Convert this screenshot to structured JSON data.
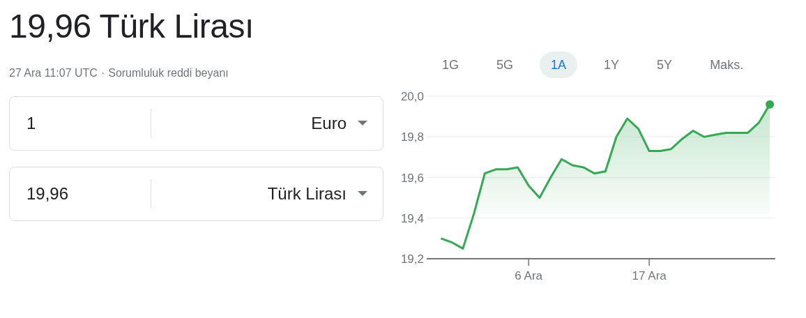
{
  "title": "19,96 Türk Lirası",
  "meta": {
    "timestamp": "27 Ara 11:07 UTC",
    "separator": "·",
    "disclaimer": "Sorumluluk reddi beyanı"
  },
  "converter": [
    {
      "amount": "1",
      "currency": "Euro"
    },
    {
      "amount": "19,96",
      "currency": "Türk Lirası"
    }
  ],
  "ranges": [
    {
      "label": "1G",
      "selected": false
    },
    {
      "label": "5G",
      "selected": false
    },
    {
      "label": "1A",
      "selected": true
    },
    {
      "label": "1Y",
      "selected": false
    },
    {
      "label": "5Y",
      "selected": false
    },
    {
      "label": "Maks.",
      "selected": false
    }
  ],
  "chart_data": {
    "type": "area",
    "categories": [
      null,
      null,
      null,
      null,
      null,
      null,
      null,
      null,
      "6 Ara",
      null,
      null,
      null,
      null,
      null,
      null,
      null,
      null,
      null,
      null,
      "17 Ara",
      null,
      null,
      null,
      null,
      null,
      null,
      null,
      null,
      null,
      null,
      null
    ],
    "series": [
      {
        "color": "#34a853",
        "values": [
          19.3,
          19.28,
          19.25,
          19.42,
          19.62,
          19.64,
          19.64,
          19.65,
          19.56,
          19.5,
          19.6,
          19.69,
          19.66,
          19.65,
          19.62,
          19.63,
          19.8,
          19.89,
          19.84,
          19.73,
          19.73,
          19.74,
          19.79,
          19.83,
          19.8,
          19.81,
          19.82,
          19.82,
          19.82,
          19.87,
          19.96
        ]
      }
    ],
    "ylim": [
      19.2,
      20.0
    ],
    "grid": true,
    "yticks": [
      {
        "value": 20.0,
        "label": "20,0"
      },
      {
        "value": 19.8,
        "label": "19,8"
      },
      {
        "value": 19.6,
        "label": "19,6"
      },
      {
        "value": 19.4,
        "label": "19,4"
      },
      {
        "value": 19.2,
        "label": "19,2"
      }
    ]
  }
}
